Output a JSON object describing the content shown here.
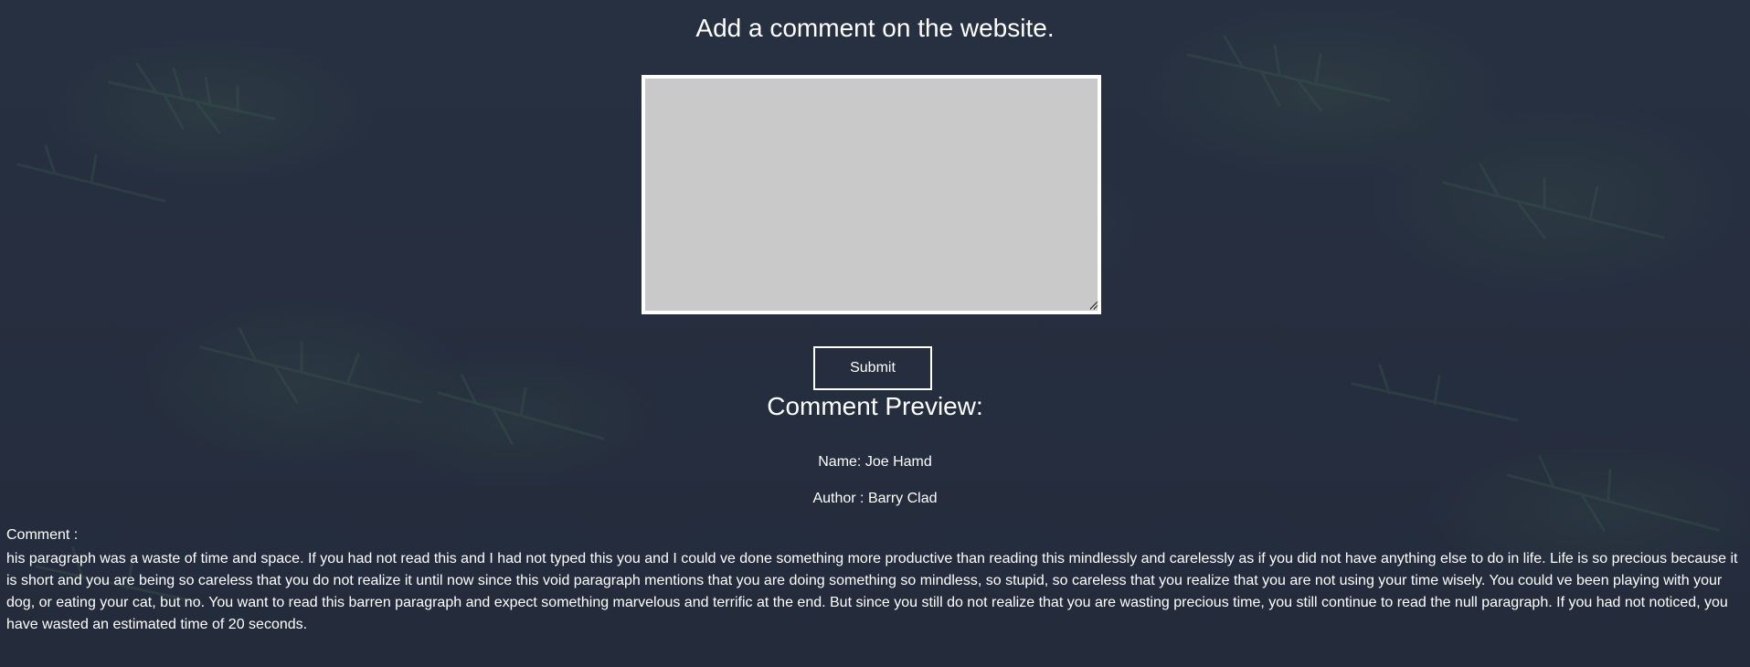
{
  "header": {
    "title": "Add a comment on the website."
  },
  "form": {
    "comment_value": "",
    "submit_label": "Submit"
  },
  "preview": {
    "title": "Comment Preview:",
    "name_line": "Name: Joe Hamd",
    "author_line": "Author : Barry Clad",
    "comment_label": "Comment :",
    "comment_text": "his paragraph was a waste of time and space. If you had not read this and I had not typed this you and I could ve done something more productive than reading this mindlessly and carelessly as if you did not have anything else to do in life. Life is so precious because it is short and you are being so careless that you do not realize it until now since this void paragraph mentions that you are doing something so mindless, so stupid, so careless that you realize that you are not using your time wisely. You could ve been playing with your dog, or eating your cat, but no. You want to read this barren paragraph and expect something marvelous and terrific at the end. But since you still do not realize that you are wasting precious time, you still continue to read the null paragraph. If you had not noticed, you have wasted an estimated time of 20 seconds."
  },
  "colors": {
    "background": "#273041",
    "textarea_bg": "#c9c9c9",
    "text": "#ffffff"
  }
}
